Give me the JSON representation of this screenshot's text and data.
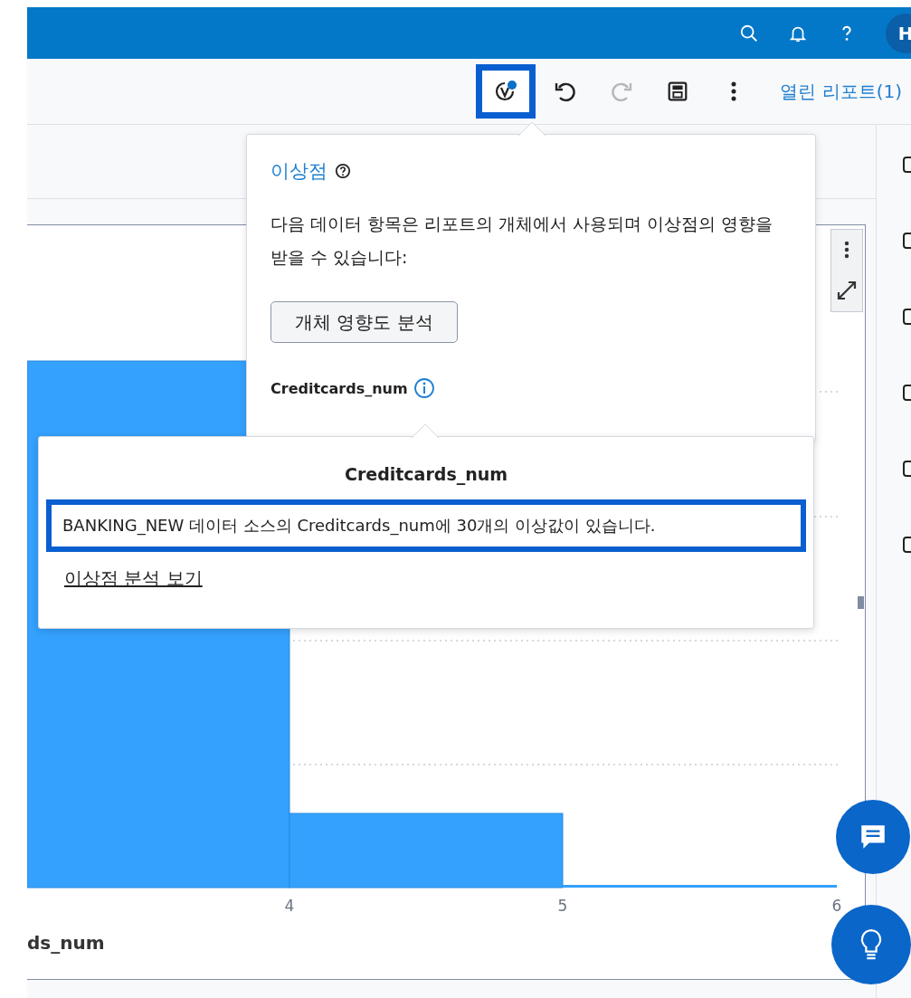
{
  "app_bar": {
    "avatar": "H"
  },
  "toolbar": {
    "items": [
      {
        "kind": "outlier",
        "highlighted": true,
        "has_alert": true
      },
      {
        "kind": "undo",
        "highlighted": false,
        "disabled": false
      },
      {
        "kind": "redo",
        "highlighted": false,
        "disabled": true
      },
      {
        "kind": "save",
        "highlighted": false
      },
      {
        "kind": "more",
        "highlighted": false
      }
    ],
    "open_reports": "열린 리포트(1)"
  },
  "chart": {
    "x_tick_labels": [
      "4",
      "5",
      "6"
    ],
    "x_axis_label": "ds_num"
  },
  "outlier_popover": {
    "title": "이상점",
    "description": "다음 데이터 항목은 리포트의 개체에서 사용되며 이상점의 영향을 받을 수 있습니다:",
    "button": "개체 영향도 분석",
    "data_item": "Creditcards_num"
  },
  "detail_popover": {
    "title": "Creditcards_num",
    "message": "BANKING_NEW 데이터 소스의 Creditcards_num에 30개의 이상값이 있습니다.",
    "message_highlighted": true,
    "link": "이상점 분석 보기"
  }
}
